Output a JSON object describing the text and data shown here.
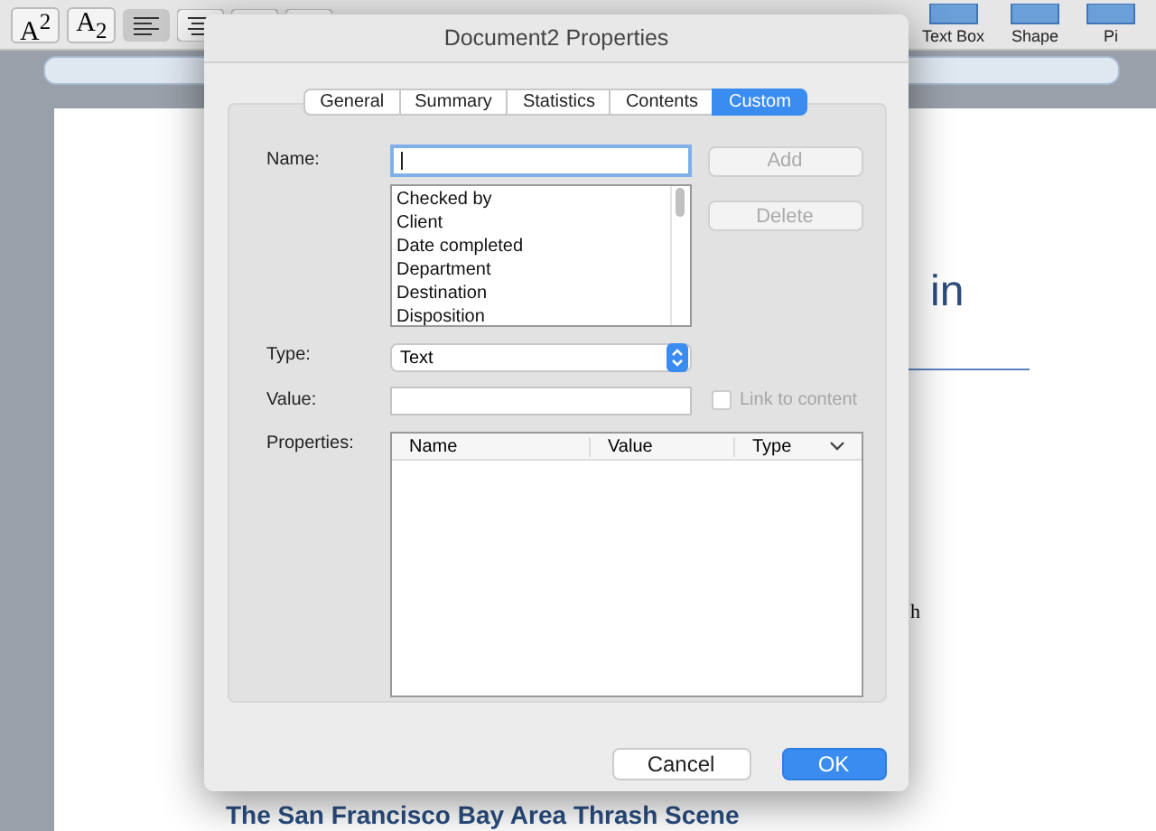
{
  "toolbar": {
    "format_buttons": [
      {
        "label": "A$^{2}$"
      },
      {
        "label": "A$_{2}$"
      }
    ],
    "insert_buttons": [
      {
        "label": "Text Box"
      },
      {
        "label": "Shape"
      },
      {
        "label": "Pi"
      }
    ]
  },
  "document": {
    "heading_fragment": "in",
    "text_fragment": "h",
    "subheading": "The San Francisco Bay Area Thrash Scene"
  },
  "dialog": {
    "title": "Document2 Properties",
    "tabs": [
      {
        "label": "General",
        "selected": false
      },
      {
        "label": "Summary",
        "selected": false
      },
      {
        "label": "Statistics",
        "selected": false
      },
      {
        "label": "Contents",
        "selected": false
      },
      {
        "label": "Custom",
        "selected": true
      }
    ],
    "name_label": "Name:",
    "add_button": {
      "label": "Add",
      "disabled": true
    },
    "delete_button": {
      "label": "Delete",
      "disabled": true
    },
    "name_list": [
      "Checked by",
      "Client",
      "Date completed",
      "Department",
      "Destination",
      "Disposition"
    ],
    "type_label": "Type:",
    "type_value": "Text",
    "value_label": "Value:",
    "link_to_content": {
      "label": "Link to content",
      "checked": false,
      "disabled": true
    },
    "properties_label": "Properties:",
    "columns": [
      "Name",
      "Value",
      "Type"
    ],
    "buttons": [
      {
        "label": "Cancel",
        "default": false
      },
      {
        "label": "OK",
        "default": true
      }
    ]
  }
}
